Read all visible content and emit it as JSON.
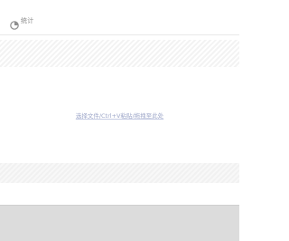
{
  "header": {
    "icon": "chart-icon",
    "label": "统计"
  },
  "drop_zone": {
    "hint": "选择文件/Ctrl+V粘贴/拖拽至此处"
  },
  "colors": {
    "header_text": "#8a8a8a",
    "hint_text": "#9ea7c9",
    "bottom_panel": "#dcdcdc"
  }
}
